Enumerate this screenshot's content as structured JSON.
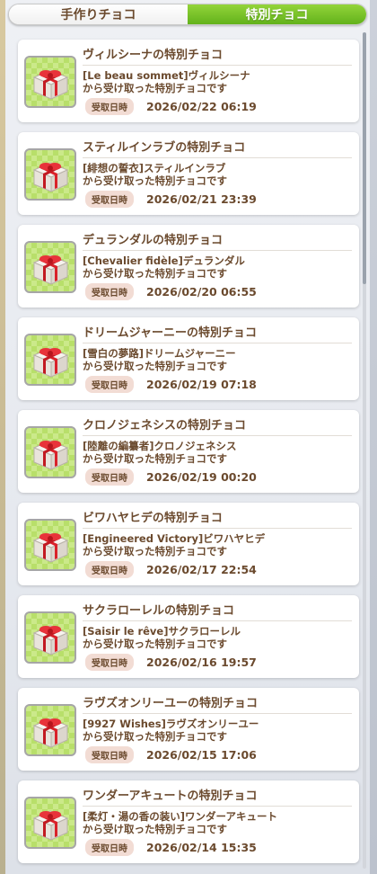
{
  "tabs": [
    {
      "label": "手作りチョコ",
      "active": false
    },
    {
      "label": "特別チョコ",
      "active": true
    }
  ],
  "colors": {
    "accent_green": "#62b21b",
    "text_brown": "#6b4a2e",
    "badge_bg": "#f2dcd4",
    "thumb_bg": "#cbe98a",
    "ribbon_red": "#d9222a"
  },
  "badge_label": "受取日時",
  "received_suffix": "から受け取った特別チョコです",
  "items": [
    {
      "title": "ヴィルシーナの特別チョコ",
      "line1": "[Le beau sommet]ヴィルシーナ",
      "date": "2026/02/22 06:19",
      "icon": "gift-box-icon"
    },
    {
      "title": "スティルインラブの特別チョコ",
      "line1": "[緋想の誓衣]スティルインラブ",
      "date": "2026/02/21 23:39",
      "icon": "gift-box-icon"
    },
    {
      "title": "デュランダルの特別チョコ",
      "line1": "[Chevalier fidèle]デュランダル",
      "date": "2026/02/20 06:55",
      "icon": "gift-box-icon"
    },
    {
      "title": "ドリームジャーニーの特別チョコ",
      "line1": "[雪白の夢路]ドリームジャーニー",
      "date": "2026/02/19 07:18",
      "icon": "gift-box-icon"
    },
    {
      "title": "クロノジェネシスの特別チョコ",
      "line1": "[陸離の編纂者]クロノジェネシス",
      "date": "2026/02/19 00:20",
      "icon": "gift-box-icon"
    },
    {
      "title": "ビワハヤヒデの特別チョコ",
      "line1": "[Engineered Victory]ビワハヤヒデ",
      "date": "2026/02/17 22:54",
      "icon": "gift-box-icon"
    },
    {
      "title": "サクラローレルの特別チョコ",
      "line1": "[Saisir le rêve]サクラローレル",
      "date": "2026/02/16 19:57",
      "icon": "gift-box-icon"
    },
    {
      "title": "ラヴズオンリーユーの特別チョコ",
      "line1": "[9927 Wishes]ラヴズオンリーユー",
      "date": "2026/02/15 17:06",
      "icon": "gift-box-icon"
    },
    {
      "title": "ワンダーアキュートの特別チョコ",
      "line1": "[柔灯・湯の香の装い]ワンダーアキュート",
      "date": "2026/02/14 15:35",
      "icon": "gift-box-icon"
    }
  ]
}
